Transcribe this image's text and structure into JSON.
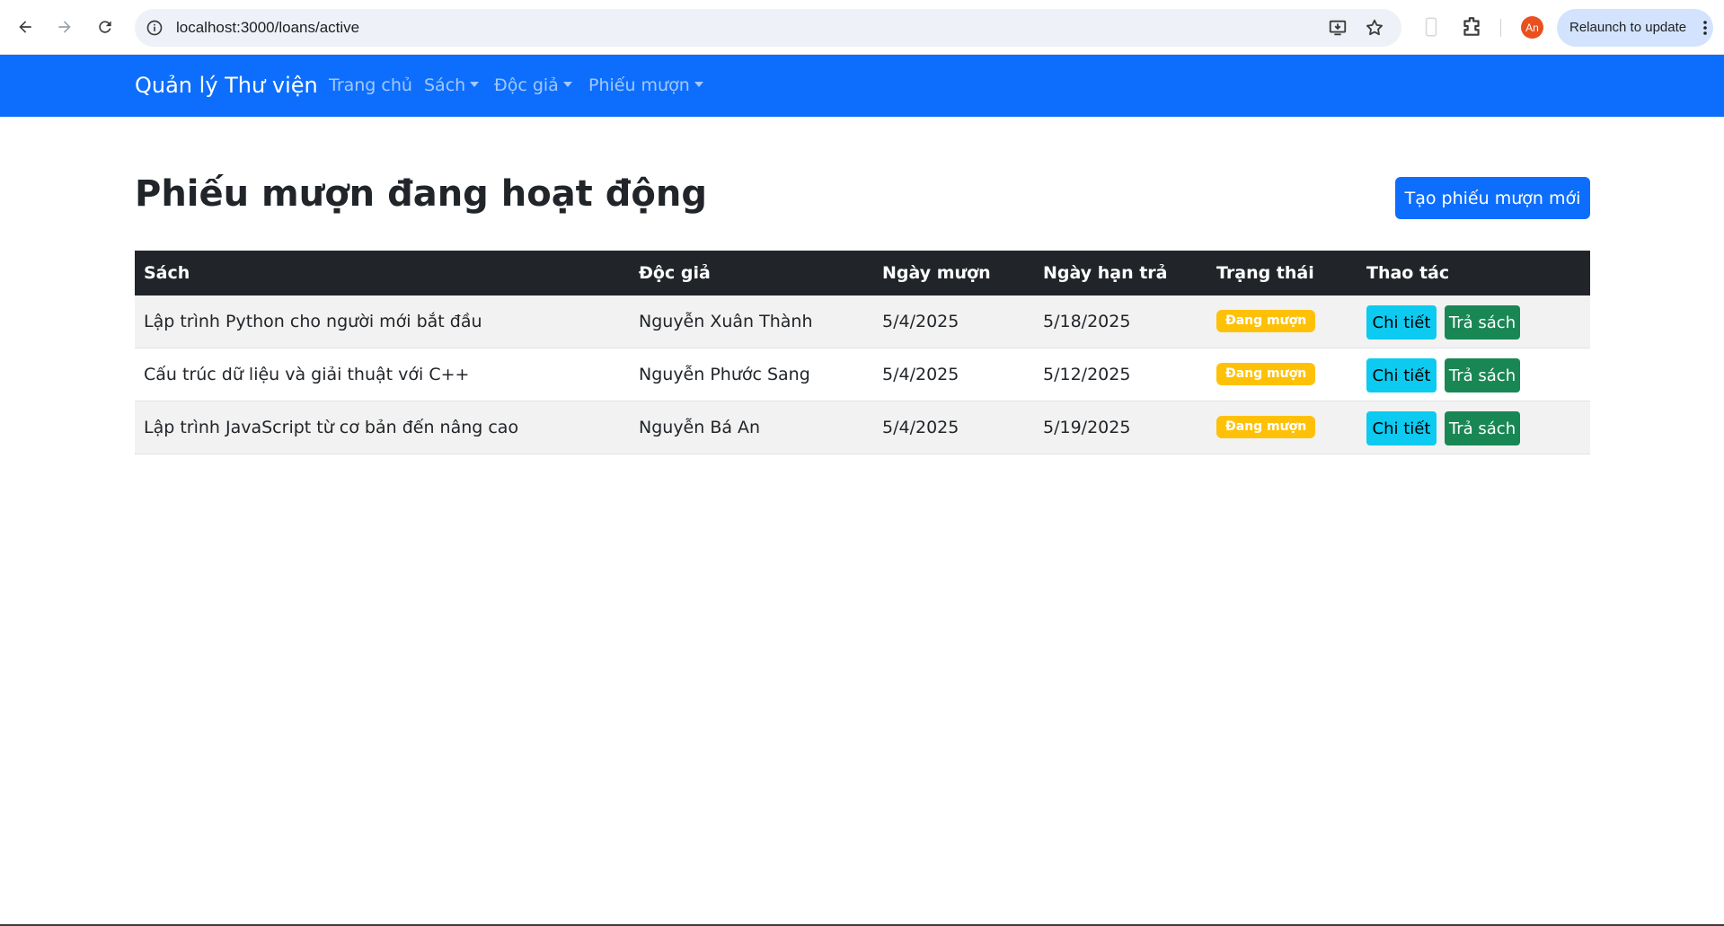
{
  "browser": {
    "url": "localhost:3000/loans/active",
    "profile_initials": "An",
    "relaunch_label": "Relaunch to update"
  },
  "navbar": {
    "brand": "Quản lý Thư viện",
    "links": [
      {
        "label": "Trang chủ",
        "dropdown": false
      },
      {
        "label": "Sách",
        "dropdown": true
      },
      {
        "label": "Độc giả",
        "dropdown": true
      },
      {
        "label": "Phiếu mượn",
        "dropdown": true
      }
    ]
  },
  "page": {
    "title": "Phiếu mượn đang hoạt động",
    "create_button": "Tạo phiếu mượn mới"
  },
  "table": {
    "headers": [
      "Sách",
      "Độc giả",
      "Ngày mượn",
      "Ngày hạn trả",
      "Trạng thái",
      "Thao tác"
    ],
    "rows": [
      {
        "book": "Lập trình Python cho người mới bắt đầu",
        "reader": "Nguyễn Xuân Thành",
        "borrow_date": "5/4/2025",
        "due_date": "5/18/2025",
        "status": "Đang mượn",
        "detail_label": "Chi tiết",
        "return_label": "Trả sách"
      },
      {
        "book": "Cấu trúc dữ liệu và giải thuật với C++",
        "reader": "Nguyễn Phước Sang",
        "borrow_date": "5/4/2025",
        "due_date": "5/12/2025",
        "status": "Đang mượn",
        "detail_label": "Chi tiết",
        "return_label": "Trả sách"
      },
      {
        "book": "Lập trình JavaScript từ cơ bản đến nâng cao",
        "reader": "Nguyễn Bá An",
        "borrow_date": "5/4/2025",
        "due_date": "5/19/2025",
        "status": "Đang mượn",
        "detail_label": "Chi tiết",
        "return_label": "Trả sách"
      }
    ]
  },
  "colors": {
    "primary": "#0d6efd",
    "table_header": "#212529",
    "badge_warning": "#ffc107",
    "btn_info": "#0dcaf0",
    "btn_success": "#198754"
  }
}
